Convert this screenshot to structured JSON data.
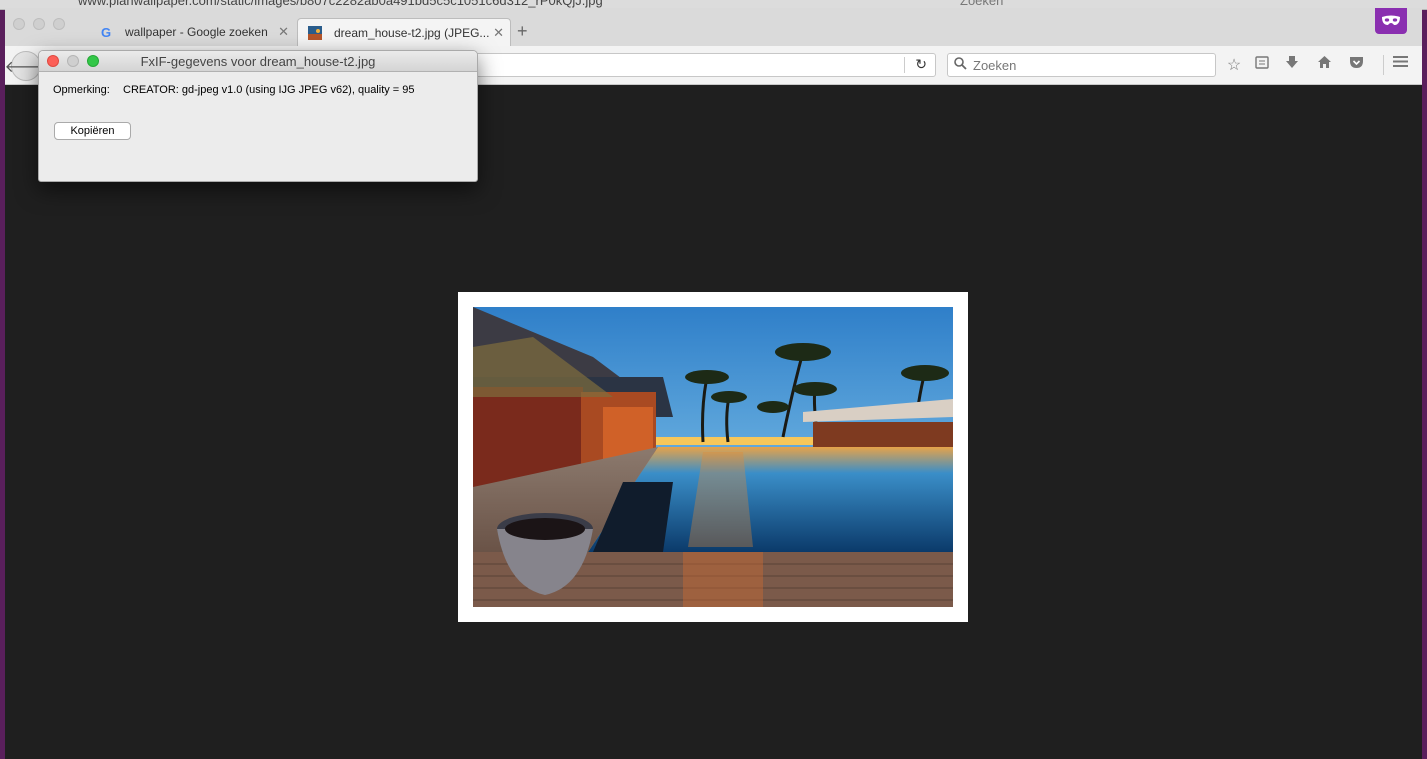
{
  "background_window": {
    "url": "www.planwallpaper.com/static/images/b807c2282ab0a491bd5c5c1051c6d312_rP0kQjJ.jpg",
    "search_placeholder": "Zoeken"
  },
  "tabs": [
    {
      "label": "wallpaper - Google zoeken",
      "favicon": "google-icon",
      "active": false
    },
    {
      "label": "dream_house-t2.jpg (JPEG...",
      "favicon": "image-thumbnail-icon",
      "active": true
    }
  ],
  "navbar": {
    "url_value": "",
    "search_placeholder": "Zoeken"
  },
  "dialog": {
    "title": "FxIF-gegevens voor dream_house-t2.jpg",
    "comment_label": "Opmerking:",
    "comment_value": "CREATOR: gd-jpeg v1.0 (using IJG JPEG v62), quality = 95",
    "copy_button": "Kopiëren"
  },
  "colors": {
    "viewer_bg": "#1f1f1f",
    "private_accent": "#8a2fb0",
    "close_red": "#fc5f57",
    "minimize_gray": "#cfcfcf",
    "zoom_green": "#33c748"
  }
}
